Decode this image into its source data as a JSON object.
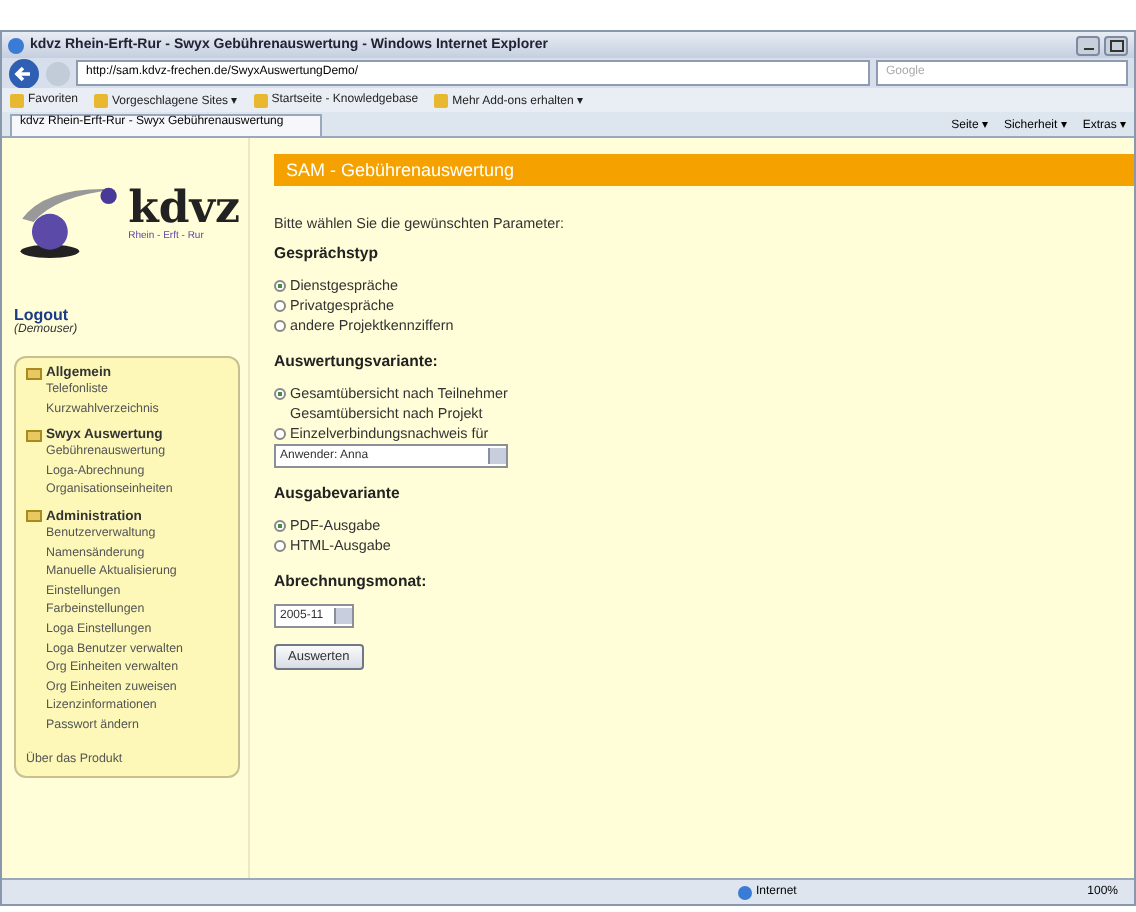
{
  "window": {
    "title": "kdvz Rhein-Erft-Rur - Swyx Gebührenauswertung - Windows Internet Explorer"
  },
  "address_bar": {
    "value": "http://sam.kdvz-frechen.de/SwyxAuswertungDemo/"
  },
  "search": {
    "placeholder": "Google"
  },
  "favorites_bar": {
    "items": [
      "Favoriten",
      "Vorgeschlagene Sites ▾",
      "Startseite - Knowledgebase",
      "Mehr Add-ons erhalten ▾"
    ]
  },
  "tab": {
    "label": "kdvz Rhein-Erft-Rur - Swyx Gebührenauswertung"
  },
  "command_bar": [
    "Seite ▾",
    "Sicherheit ▾",
    "Extras ▾"
  ],
  "sidebar": {
    "logo_text": "kdvz",
    "logo_subtext": "Rhein - Erft - Rur",
    "logout": "Logout",
    "user": "(Demouser)",
    "groups": [
      {
        "title": "Allgemein",
        "children": [
          "Telefonliste",
          "Kurzwahlverzeichnis"
        ]
      },
      {
        "title": "Swyx Auswertung",
        "children": [
          "Gebührenauswertung",
          "Loga-Abrechnung",
          "Organisationseinheiten"
        ]
      },
      {
        "title": "Administration",
        "children": [
          "Benutzerverwaltung",
          "Namensänderung",
          "Manuelle Aktualisierung",
          "Einstellungen",
          "Farbeinstellungen",
          "Loga Einstellungen",
          "Loga Benutzer verwalten",
          "Org Einheiten verwalten",
          "Org Einheiten zuweisen",
          "Lizenzinformationen",
          "Passwort ändern"
        ]
      }
    ],
    "footer_link": "Über das Produkt"
  },
  "header": {
    "title": "SAM - Gebührenauswertung"
  },
  "intro": "Bitte wählen Sie die gewünschten Parameter:",
  "sections": [
    {
      "title": "Gesprächstyp",
      "options": [
        {
          "kind": "radio",
          "label": "Dienstgespräche",
          "selected": true
        },
        {
          "kind": "radio",
          "label": "Privatgespräche",
          "selected": false
        },
        {
          "kind": "radio",
          "label": "andere Projektkennziffern",
          "selected": false
        }
      ]
    },
    {
      "title": "Auswertungsvariante:",
      "options": [
        {
          "kind": "radio",
          "label": "Gesamtübersicht nach Teilnehmer",
          "selected": true
        },
        {
          "kind": "plain",
          "label": "Gesamtübersicht nach Projekt"
        },
        {
          "kind": "radio",
          "label": "Einzelverbindungsnachweis für",
          "selected": false
        },
        {
          "kind": "select",
          "label": "Anwender: Anna"
        }
      ]
    },
    {
      "title": "Ausgabevariante",
      "options": [
        {
          "kind": "radio",
          "label": "PDF-Ausgabe",
          "selected": true
        },
        {
          "kind": "radio",
          "label": "HTML-Ausgabe",
          "selected": false
        }
      ]
    },
    {
      "title": "Abrechnungsmonat:",
      "options": [
        {
          "kind": "select-small",
          "label": "2005-11"
        }
      ]
    }
  ],
  "submit": "Auswerten",
  "status_bar": {
    "zone": "Internet",
    "zoom": "100%"
  }
}
